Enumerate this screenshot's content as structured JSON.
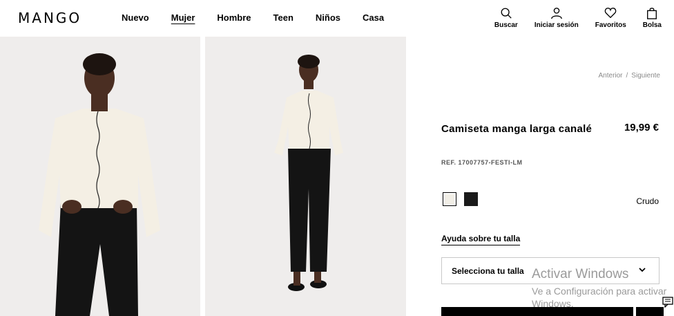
{
  "header": {
    "logo": "MANGO",
    "nav": [
      "Nuevo",
      "Mujer",
      "Hombre",
      "Teen",
      "Niños",
      "Casa"
    ],
    "active_nav": "Mujer",
    "actions": [
      {
        "label": "Buscar",
        "icon": "search-icon"
      },
      {
        "label": "Iniciar sesión",
        "icon": "user-icon"
      },
      {
        "label": "Favoritos",
        "icon": "heart-icon"
      },
      {
        "label": "Bolsa",
        "icon": "bag-icon"
      }
    ]
  },
  "breadcrumb": {
    "prev": "Anterior",
    "separator": "/",
    "next": "Siguiente"
  },
  "product": {
    "title": "Camiseta manga larga canalé",
    "price": "19,99 €",
    "ref": "REF. 17007757-FESTI-LM",
    "colors": [
      {
        "name": "Crudo",
        "hex": "#f1eee6",
        "selected": true
      },
      {
        "name": "Negro",
        "hex": "#1a1a1a",
        "selected": false
      }
    ],
    "selected_color_name": "Crudo",
    "size_help": "Ayuda sobre tu talla",
    "size_select_placeholder": "Selecciona tu talla"
  },
  "watermark": {
    "line1": "Activar Windows",
    "line2": "Ve a Configuración para activar Windows."
  },
  "colors": {
    "background": "#ffffff",
    "photo_bg": "#efedec",
    "muted": "#8a8a8a",
    "border": "#c8c8c8"
  }
}
